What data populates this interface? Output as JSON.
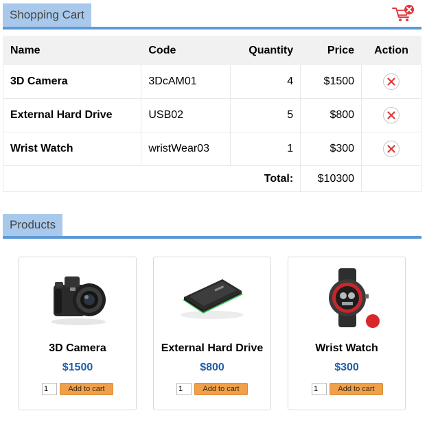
{
  "cart": {
    "title": "Shopping Cart",
    "columns": [
      "Name",
      "Code",
      "Quantity",
      "Price",
      "Action"
    ],
    "items": [
      {
        "name": "3D Camera",
        "code": "3DcAM01",
        "quantity": "4",
        "price": "$1500"
      },
      {
        "name": "External Hard Drive",
        "code": "USB02",
        "quantity": "5",
        "price": "$800"
      },
      {
        "name": "Wrist Watch",
        "code": "wristWear03",
        "quantity": "1",
        "price": "$300"
      }
    ],
    "total_label": "Total:",
    "total_value": "$10300",
    "empty_icon": "empty-cart-icon",
    "remove_icon": "remove-icon"
  },
  "products": {
    "title": "Products",
    "items": [
      {
        "name": "3D Camera",
        "price": "$1500",
        "qty": "1",
        "button": "Add to cart",
        "icon": "camera-icon"
      },
      {
        "name": "External Hard Drive",
        "price": "$800",
        "qty": "1",
        "button": "Add to cart",
        "icon": "hard-drive-icon"
      },
      {
        "name": "Wrist Watch",
        "price": "$300",
        "qty": "1",
        "button": "Add to cart",
        "icon": "wrist-watch-icon"
      }
    ]
  },
  "colors": {
    "accent": "#5c9ad6",
    "tab": "#a9c9ec",
    "price": "#1f5fa9",
    "button": "#f0a04b",
    "remove": "#e0383a"
  }
}
